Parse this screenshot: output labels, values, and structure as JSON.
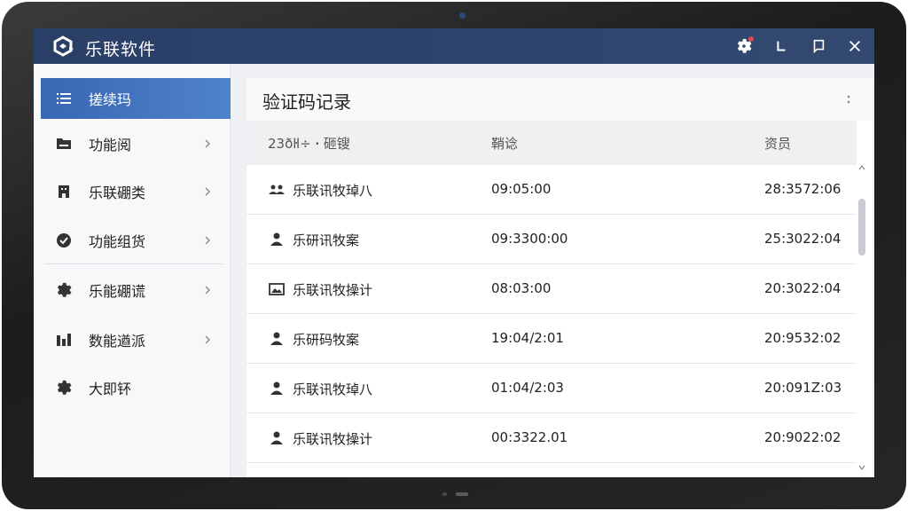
{
  "app": {
    "title": "乐联软件"
  },
  "titlebar_buttons": [
    {
      "name": "settings-icon",
      "has_notification": true
    },
    {
      "name": "back-icon"
    },
    {
      "name": "restore-icon"
    },
    {
      "name": "close-icon"
    }
  ],
  "sidebar": {
    "items": [
      {
        "label": "搓续玛",
        "icon": "list-icon",
        "active": true,
        "chevron": false
      },
      {
        "label": "功能阅",
        "icon": "folder-icon",
        "active": false,
        "chevron": true
      },
      {
        "label": "乐联硼类",
        "icon": "building-icon",
        "active": false,
        "chevron": true
      },
      {
        "label": "功能组货",
        "icon": "check-circle-icon",
        "active": false,
        "chevron": true
      },
      {
        "label": "乐能硼谎",
        "icon": "gear-icon",
        "active": false,
        "chevron": true
      },
      {
        "label": "数能遒派",
        "icon": "chart-icon",
        "active": false,
        "chevron": true
      },
      {
        "label": "大即钚",
        "icon": "gear-icon",
        "active": false,
        "chevron": false
      }
    ]
  },
  "main": {
    "title": "验证码记录",
    "columns": [
      "23ðŀl÷ ꞏ 砸锼",
      "鞘谂",
      "资员"
    ],
    "rows": [
      {
        "icon": "users-icon",
        "name": "乐联讯牧琸八",
        "time": "09:05:00",
        "value": "28:3572:06"
      },
      {
        "icon": "user-icon",
        "name": "乐研讯牧案",
        "time": "09:3300:00",
        "value": "25:3022:04"
      },
      {
        "icon": "image-icon",
        "name": "乐联讯牧操计",
        "time": "08:03:00",
        "value": "20:3022:04"
      },
      {
        "icon": "user-icon",
        "name": "乐研码牧案",
        "time": "19:04/2:01",
        "value": "20:9532:02"
      },
      {
        "icon": "user-icon",
        "name": "乐联讯牧琸八",
        "time": "01:04/2:03",
        "value": "20:091Z:03"
      },
      {
        "icon": "user-icon",
        "name": "乐联讯牧操计",
        "time": "00:3322.01",
        "value": "20:9022:02"
      }
    ]
  },
  "colors": {
    "titlebar": "#2d4470",
    "active_item": "#3f72bf",
    "notification": "#e24b4b"
  }
}
